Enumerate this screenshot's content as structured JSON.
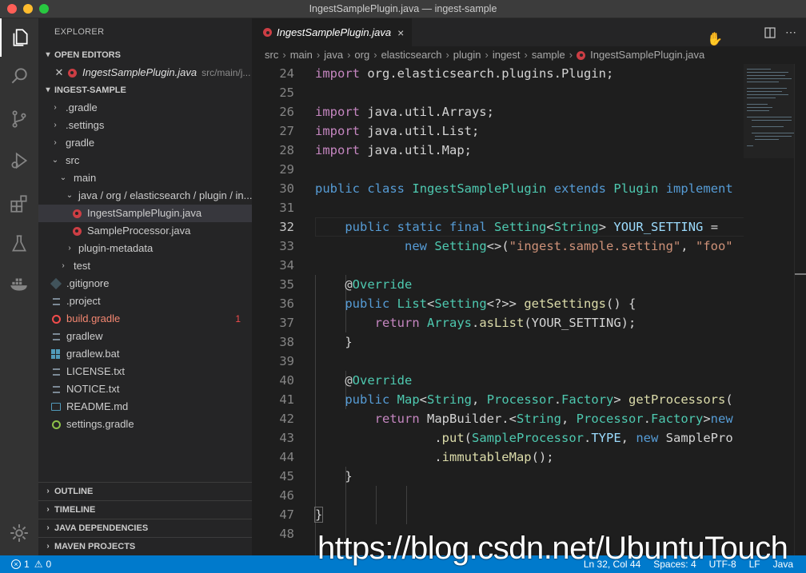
{
  "window": {
    "title": "IngestSamplePlugin.java — ingest-sample"
  },
  "activity_bar": {
    "items": [
      "explorer-icon",
      "search-icon",
      "source-control-icon",
      "run-debug-icon",
      "extensions-icon",
      "testing-icon",
      "docker-icon"
    ],
    "bottom": "gear-icon"
  },
  "sidebar": {
    "title": "EXPLORER",
    "open_editors": {
      "header": "OPEN EDITORS",
      "items": [
        {
          "name": "IngestSamplePlugin.java",
          "path": "src/main/j..."
        }
      ]
    },
    "project": {
      "header": "INGEST-SAMPLE",
      "tree": [
        {
          "label": ".gradle"
        },
        {
          "label": ".settings"
        },
        {
          "label": "gradle"
        },
        {
          "label": "src"
        },
        {
          "label": "main"
        },
        {
          "label": "java / org / elasticsearch / plugin / in..."
        },
        {
          "label": "IngestSamplePlugin.java"
        },
        {
          "label": "SampleProcessor.java"
        },
        {
          "label": "plugin-metadata"
        },
        {
          "label": "test"
        },
        {
          "label": ".gitignore"
        },
        {
          "label": ".project"
        },
        {
          "label": "build.gradle",
          "badge": "1"
        },
        {
          "label": "gradlew"
        },
        {
          "label": "gradlew.bat"
        },
        {
          "label": "LICENSE.txt"
        },
        {
          "label": "NOTICE.txt"
        },
        {
          "label": "README.md"
        },
        {
          "label": "settings.gradle"
        }
      ]
    },
    "bottom_sections": [
      "OUTLINE",
      "TIMELINE",
      "JAVA DEPENDENCIES",
      "MAVEN PROJECTS"
    ]
  },
  "editor": {
    "tab": {
      "label": "IngestSamplePlugin.java",
      "close": "×"
    },
    "breadcrumbs": [
      "src",
      "main",
      "java",
      "org",
      "elasticsearch",
      "plugin",
      "ingest",
      "sample",
      "IngestSamplePlugin.java"
    ],
    "line_numbers": [
      "24",
      "25",
      "26",
      "27",
      "28",
      "29",
      "30",
      "31",
      "32",
      "33",
      "34",
      "35",
      "36",
      "37",
      "38",
      "39",
      "40",
      "41",
      "42",
      "43",
      "44",
      "45",
      "46",
      "47",
      "48"
    ]
  },
  "status_bar": {
    "errors": "1",
    "warnings": "0",
    "position": "Ln 32, Col 44",
    "spaces": "Spaces: 4",
    "encoding": "UTF-8",
    "eol": "LF",
    "language": "Java"
  },
  "watermark": {
    "text": "https://blog.csdn.net/UbuntuTouch"
  }
}
